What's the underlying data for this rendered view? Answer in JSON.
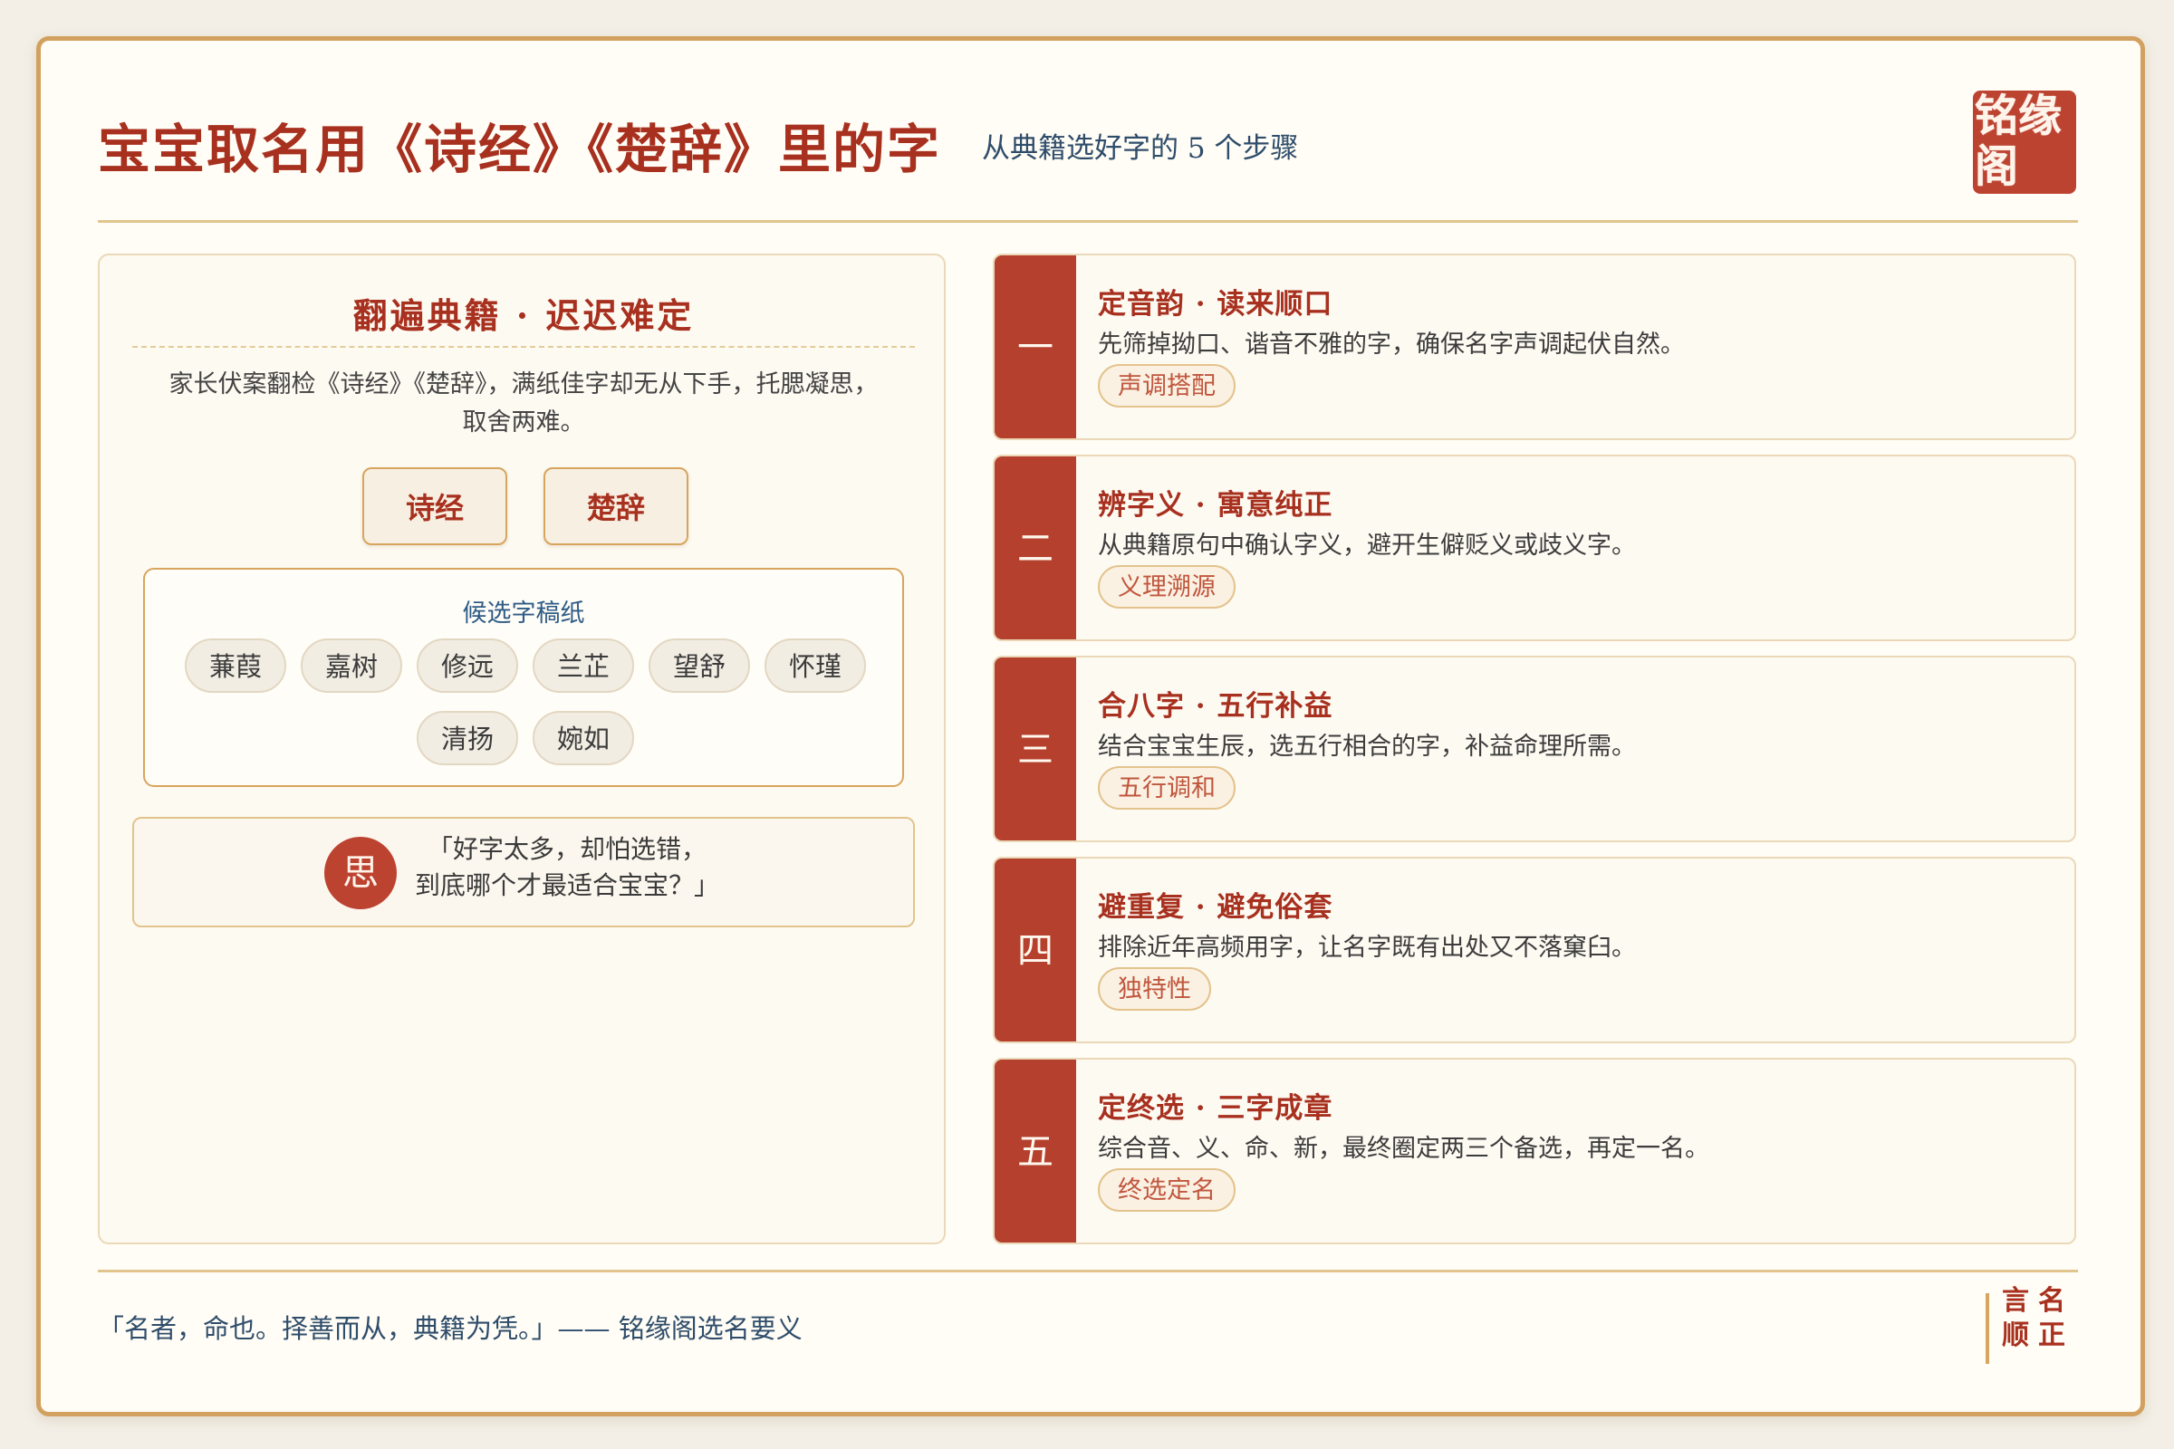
{
  "header": {
    "title": "宝宝取名用《诗经》《楚辞》里的字",
    "subtitle": "从典籍选好字的 5 个步骤",
    "seal": "铭缘阁"
  },
  "left_panel": {
    "title": "翻遍典籍 · 迟迟难定",
    "desc_line1": "家长伏案翻检《诗经》《楚辞》，满纸佳字却无从下手，托腮凝思，",
    "desc_line2": "取舍两难。",
    "books": [
      "诗经",
      "楚辞"
    ],
    "draft_title": "候选字稿纸",
    "candidates": [
      "蒹葭",
      "嘉树",
      "修远",
      "兰芷",
      "望舒",
      "怀瑾",
      "清扬",
      "婉如"
    ],
    "thought_icon": "思",
    "quote_line1": "「好字太多，却怕选错，",
    "quote_line2": "到底哪个才最适合宝宝？」"
  },
  "steps": [
    {
      "num": "一",
      "title": "定音韵 · 读来顺口",
      "desc": "先筛掉拗口、谐音不雅的字，确保名字声调起伏自然。",
      "tag": "声调搭配"
    },
    {
      "num": "二",
      "title": "辨字义 · 寓意纯正",
      "desc": "从典籍原句中确认字义，避开生僻贬义或歧义字。",
      "tag": "义理溯源"
    },
    {
      "num": "三",
      "title": "合八字 · 五行补益",
      "desc": "结合宝宝生辰，选五行相合的字，补益命理所需。",
      "tag": "五行调和"
    },
    {
      "num": "四",
      "title": "避重复 · 避免俗套",
      "desc": "排除近年高频用字，让名字既有出处又不落窠臼。",
      "tag": "独特性"
    },
    {
      "num": "五",
      "title": "定终选 · 三字成章",
      "desc": "综合音、义、命、新，最终圈定两三个备选，再定一名。",
      "tag": "终选定名"
    }
  ],
  "footer": {
    "quote": "「名者，命也。择善而从，典籍为凭。」—— 铭缘阁选名要义",
    "seal_row1": "言名",
    "seal_row2": "顺正"
  },
  "colors": {
    "accent_red": "#a8301f",
    "seal_red": "#bd4331",
    "gold": "#d2a15f",
    "navy": "#2f4d6b"
  }
}
